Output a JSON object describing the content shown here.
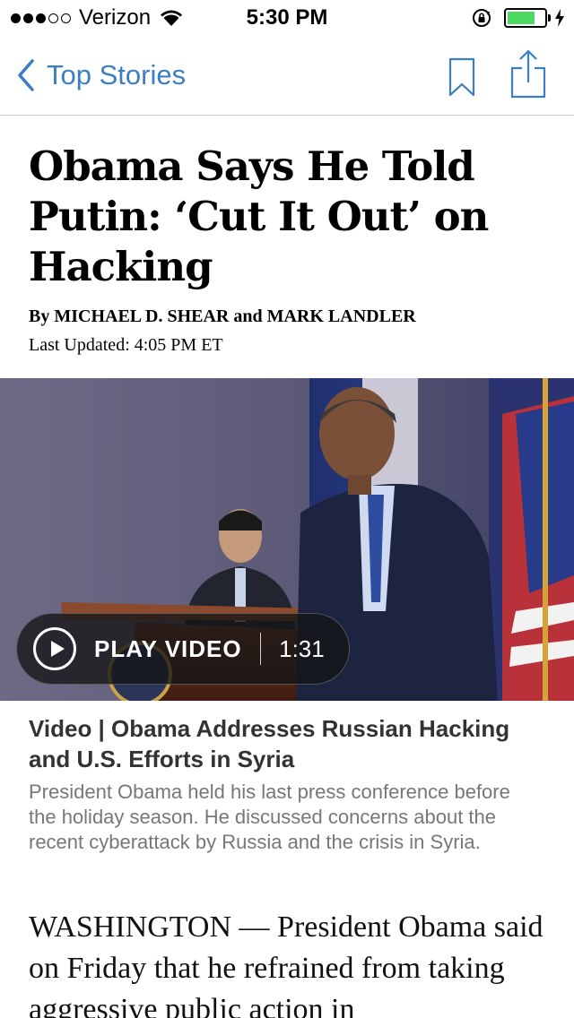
{
  "status_bar": {
    "carrier": "Verizon",
    "time": "5:30 PM",
    "signal_bars_filled": 3,
    "signal_bars_total": 5,
    "battery_level": 0.75,
    "battery_color": "#4cd964"
  },
  "nav": {
    "back_label": "Top Stories",
    "accent_color": "#3a7fc4",
    "icons": [
      "chevron-left-icon",
      "bookmark-icon",
      "share-icon"
    ]
  },
  "article": {
    "headline": "Obama Says He Told Putin: ‘Cut It Out’ on Hacking",
    "byline": "By MICHAEL D. SHEAR and MARK LANDLER",
    "updated": "Last Updated: 4:05 PM ET"
  },
  "video": {
    "play_label": "PLAY VIDEO",
    "duration": "1:31",
    "caption_title": "Video | Obama Addresses Russian Hacking and U.S. Efforts in Syria",
    "caption_desc": "President Obama held his last press conference before the holiday season. He discussed concerns about the recent cyberattack by Russia and the crisis in Syria."
  },
  "body": {
    "text": "WASHINGTON — President Obama said on Friday that he refrained from taking aggressive public action in"
  }
}
